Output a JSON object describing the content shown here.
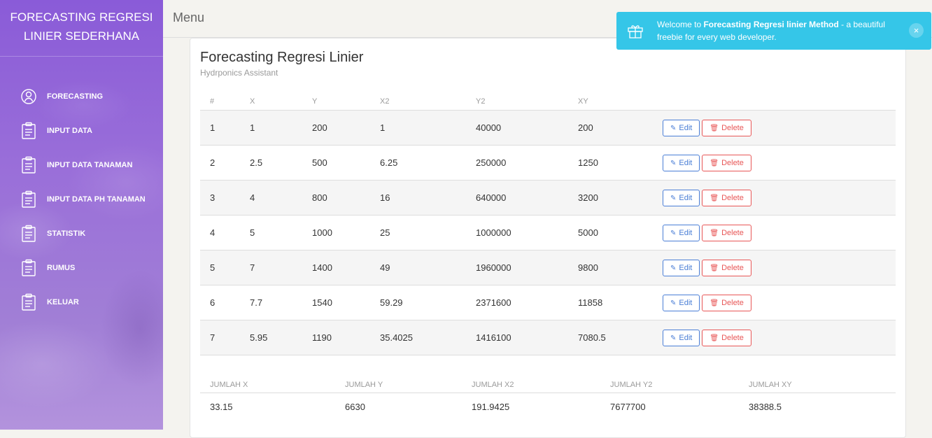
{
  "sidebar": {
    "brand_line1": "FORECASTING REGRESI",
    "brand_line2": "LINIER SEDERHANA",
    "items": [
      {
        "label": "FORECASTING",
        "icon": "user-icon"
      },
      {
        "label": "INPUT DATA",
        "icon": "clipboard-icon"
      },
      {
        "label": "INPUT DATA TANAMAN",
        "icon": "clipboard-icon"
      },
      {
        "label": "INPUT DATA PH TANAMAN",
        "icon": "clipboard-icon"
      },
      {
        "label": "STATISTIK",
        "icon": "clipboard-icon"
      },
      {
        "label": "RUMUS",
        "icon": "clipboard-icon"
      },
      {
        "label": "KELUAR",
        "icon": "clipboard-icon"
      }
    ]
  },
  "topbar": {
    "title": "Menu"
  },
  "card": {
    "title": "Forecasting Regresi Linier",
    "subtitle": "Hydrponics Assistant"
  },
  "table": {
    "headers": [
      "#",
      "X",
      "Y",
      "X2",
      "Y2",
      "XY"
    ],
    "rows": [
      [
        "1",
        "1",
        "200",
        "1",
        "40000",
        "200"
      ],
      [
        "2",
        "2.5",
        "500",
        "6.25",
        "250000",
        "1250"
      ],
      [
        "3",
        "4",
        "800",
        "16",
        "640000",
        "3200"
      ],
      [
        "4",
        "5",
        "1000",
        "25",
        "1000000",
        "5000"
      ],
      [
        "5",
        "7",
        "1400",
        "49",
        "1960000",
        "9800"
      ],
      [
        "6",
        "7.7",
        "1540",
        "59.29",
        "2371600",
        "11858"
      ],
      [
        "7",
        "5.95",
        "1190",
        "35.4025",
        "1416100",
        "7080.5"
      ]
    ],
    "edit_label": "Edit",
    "delete_label": "Delete"
  },
  "summary": {
    "headers": [
      "JUMLAH X",
      "JUMLAH Y",
      "JUMLAH X2",
      "JUMLAH Y2",
      "JUMLAH XY"
    ],
    "values": [
      "33.15",
      "6630",
      "191.9425",
      "7677700",
      "38388.5"
    ]
  },
  "notification": {
    "prefix": "Welcome to ",
    "bold": "Forecasting Regresi linier Method",
    "suffix": " - a beautiful freebie for every web developer.",
    "icon": "gift-icon",
    "close": "×"
  },
  "colors": {
    "sidebar_gradient_top": "#8a5bd8",
    "notification_bg": "#35c6e8",
    "edit_blue": "#4a7ed6",
    "delete_red": "#e85656"
  }
}
